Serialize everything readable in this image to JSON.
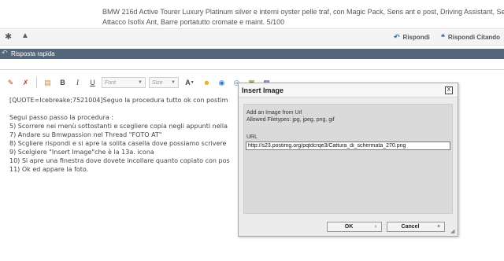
{
  "signature": {
    "line1": "BMW 216d Active Tourer Luxury Platinum silver e interni oyster pelle traf, con Magic Pack, Sens ant e post, Driving Assistant, Sedili ant sport",
    "line2": "Attacco Isofix Ant, Barre portatutto cromate e maint. 5/100"
  },
  "post_actions": {
    "reply_label": "Rispondi",
    "reply_quote_label": "Rispondi Citando",
    "left_icons": [
      "asterisk-icon",
      "warning-icon"
    ]
  },
  "quick_reply": {
    "label": "Risposta rapida"
  },
  "toolbar": {
    "font_placeholder": "Font",
    "size_placeholder": "Size",
    "buttons": [
      "remove-format-icon",
      "switch-mode-icon",
      "paste-icon",
      "bold",
      "italic",
      "underline",
      "text-color",
      "smilie-icon",
      "insert-link-icon",
      "unlink-icon",
      "insert-image-icon",
      "insert-video-icon"
    ]
  },
  "editor": {
    "lines": [
      "[QUOTE=Icebreake;7521004]Seguo la procedura tutto ok con postim",
      "",
      "Segui passo passo la procedura :",
      "5) Scorrere nei menù sottostanti e scegliere copia negli appunti nella",
      "7) Andare su Bmwpassion nel Thread \"FOTO AT\"",
      "8) Scgliere rispondi e si apre la solita casella dove possiamo scrivere",
      "9) Scelgiere \"Insert Image\"che è la 13a. icona",
      "10) Si apre una finestra dove dovete incollare quanto copiato con pos",
      "11) Ok ed appare la foto."
    ]
  },
  "dialog": {
    "title": "Insert Image",
    "close_label": "X",
    "heading": "Add an Image from Url",
    "filetypes": "Allowed Filetypes: jpg, jpeg, png, gif",
    "url_label": "URL",
    "url_value": "http://s23.postimg.org/pqtdcrqe3/Cattura_di_schermata_270.png",
    "ok_label": "OK",
    "cancel_label": "Cancel"
  }
}
